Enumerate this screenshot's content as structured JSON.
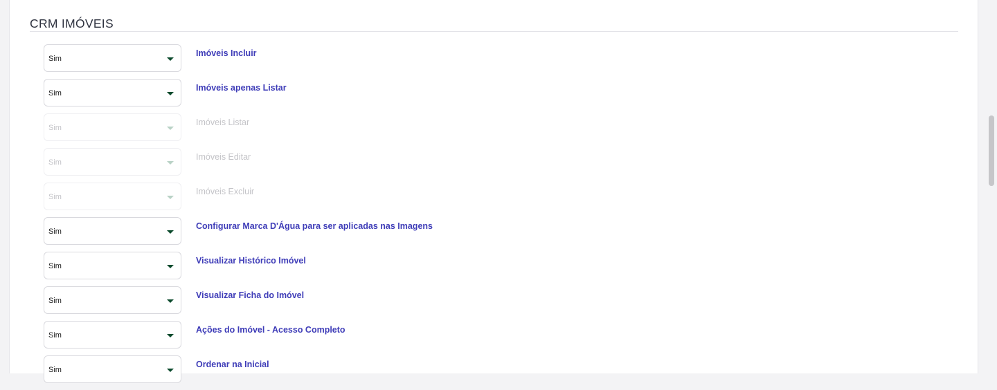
{
  "section": {
    "title": "CRM IMÓVEIS"
  },
  "permissions": [
    {
      "value": "Sim",
      "label": "Imóveis Incluir",
      "disabled": false
    },
    {
      "value": "Sim",
      "label": "Imóveis apenas Listar",
      "disabled": false
    },
    {
      "value": "Sim",
      "label": "Imóveis Listar",
      "disabled": true
    },
    {
      "value": "Sim",
      "label": "Imóveis Editar",
      "disabled": true
    },
    {
      "value": "Sim",
      "label": "Imóveis Excluir",
      "disabled": true
    },
    {
      "value": "Sim",
      "label": "Configurar Marca D'Água para ser aplicadas nas Imagens",
      "disabled": false
    },
    {
      "value": "Sim",
      "label": "Visualizar Histórico Imóvel",
      "disabled": false
    },
    {
      "value": "Sim",
      "label": "Visualizar Ficha do Imóvel",
      "disabled": false
    },
    {
      "value": "Sim",
      "label": "Ações do Imóvel - Acesso Completo",
      "disabled": false
    },
    {
      "value": "Sim",
      "label": "Ordenar na Inicial",
      "disabled": false
    }
  ],
  "colors": {
    "label_active": "#3f3db8",
    "label_disabled": "#c4c4c8",
    "caret": "#0b4a2c"
  },
  "icons": {
    "select_caret": "caret-down-icon"
  }
}
